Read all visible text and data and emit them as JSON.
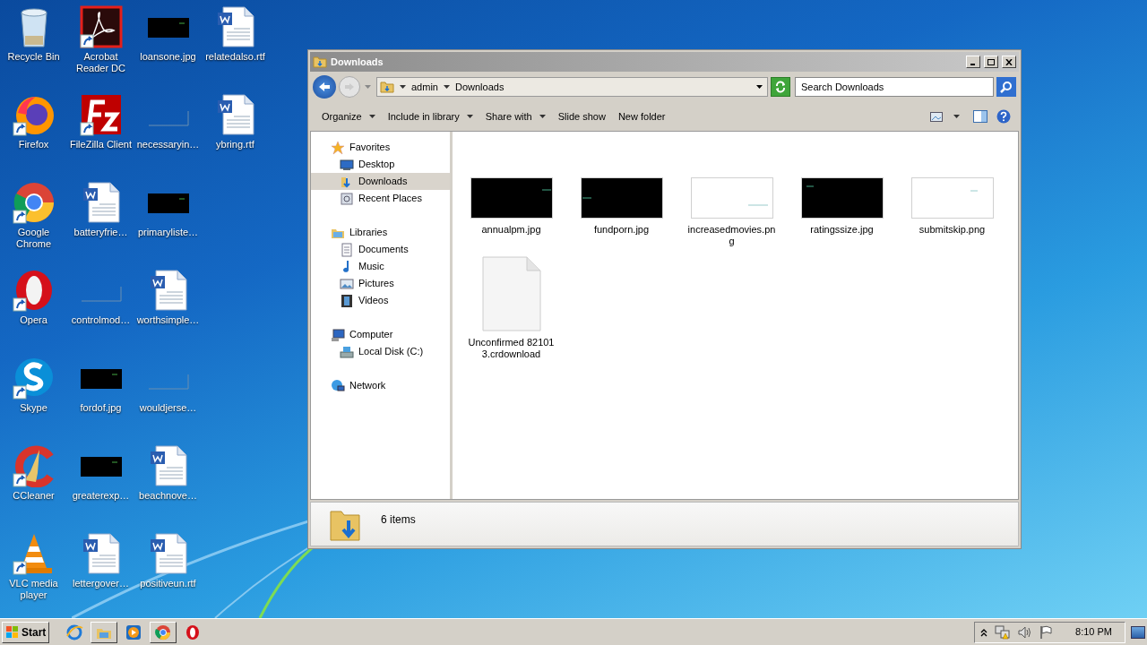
{
  "desktop": {
    "columns": [
      [
        {
          "label": "Recycle Bin",
          "kind": "recycle",
          "shortcut": false
        },
        {
          "label": "Firefox",
          "kind": "firefox",
          "shortcut": true
        },
        {
          "label": "Google Chrome",
          "kind": "chrome",
          "shortcut": true
        },
        {
          "label": "Opera",
          "kind": "opera",
          "shortcut": true
        },
        {
          "label": "Skype",
          "kind": "skype",
          "shortcut": true
        },
        {
          "label": "CCleaner",
          "kind": "ccleaner",
          "shortcut": true
        },
        {
          "label": "VLC media player",
          "kind": "vlc",
          "shortcut": true
        }
      ],
      [
        {
          "label": "Acrobat Reader DC",
          "kind": "acrobat",
          "shortcut": true
        },
        {
          "label": "FileZilla Client",
          "kind": "filezilla",
          "shortcut": true
        },
        {
          "label": "batteryfrie…",
          "kind": "word",
          "shortcut": false
        },
        {
          "label": "controlmod…",
          "kind": "blank",
          "shortcut": false
        },
        {
          "label": "fordof.jpg",
          "kind": "dark",
          "shortcut": false
        },
        {
          "label": "greaterexp…",
          "kind": "dark",
          "shortcut": false
        },
        {
          "label": "lettergover…",
          "kind": "word",
          "shortcut": false
        }
      ],
      [
        {
          "label": "loansone.jpg",
          "kind": "dark",
          "shortcut": false
        },
        {
          "label": "necessaryin…",
          "kind": "blank",
          "shortcut": false
        },
        {
          "label": "primaryliste…",
          "kind": "dark",
          "shortcut": false
        },
        {
          "label": "worthsimple…",
          "kind": "word",
          "shortcut": false
        },
        {
          "label": "wouldjerse…",
          "kind": "blank",
          "shortcut": false
        },
        {
          "label": "beachnove…",
          "kind": "word",
          "shortcut": false
        },
        {
          "label": "positiveun.rtf",
          "kind": "word",
          "shortcut": false
        }
      ],
      [
        {
          "label": "relatedalso.rtf",
          "kind": "word",
          "shortcut": false
        },
        {
          "label": "ybring.rtf",
          "kind": "word",
          "shortcut": false
        }
      ]
    ]
  },
  "window": {
    "title": "Downloads",
    "breadcrumb": [
      "admin",
      "Downloads"
    ],
    "search": {
      "placeholder": "Search Downloads"
    },
    "toolbar": [
      {
        "label": "Organize",
        "menu": true
      },
      {
        "label": "Include in library",
        "menu": true
      },
      {
        "label": "Share with",
        "menu": true
      },
      {
        "label": "Slide show",
        "menu": false
      },
      {
        "label": "New folder",
        "menu": false
      }
    ],
    "nav": [
      {
        "label": "Favorites",
        "kind": "star",
        "selected": false,
        "children": [
          {
            "label": "Desktop",
            "kind": "desktop",
            "selected": false
          },
          {
            "label": "Downloads",
            "kind": "downloads",
            "selected": true
          },
          {
            "label": "Recent Places",
            "kind": "recent",
            "selected": false
          }
        ]
      },
      {
        "label": "Libraries",
        "kind": "library",
        "selected": false,
        "children": [
          {
            "label": "Documents",
            "kind": "documents",
            "selected": false
          },
          {
            "label": "Music",
            "kind": "music",
            "selected": false
          },
          {
            "label": "Pictures",
            "kind": "pictures",
            "selected": false
          },
          {
            "label": "Videos",
            "kind": "videos",
            "selected": false
          }
        ]
      },
      {
        "label": "Computer",
        "kind": "computer",
        "selected": false,
        "children": [
          {
            "label": "Local Disk (C:)",
            "kind": "disk",
            "selected": false
          }
        ]
      },
      {
        "label": "Network",
        "kind": "network",
        "selected": false
      }
    ],
    "files": [
      {
        "name": "annualpm.jpg",
        "kind": "dark"
      },
      {
        "name": "fundporn.jpg",
        "kind": "dark"
      },
      {
        "name": "increasedmovies.png",
        "kind": "light"
      },
      {
        "name": "ratingssize.jpg",
        "kind": "dark"
      },
      {
        "name": "submitskip.png",
        "kind": "light"
      },
      {
        "name": "Unconfirmed 821013.crdownload",
        "kind": "document"
      }
    ],
    "status": "6 items"
  },
  "taskbar": {
    "start": "Start",
    "pinned": [
      {
        "kind": "ie",
        "running": false
      },
      {
        "kind": "explorer",
        "running": true
      },
      {
        "kind": "media",
        "running": false
      },
      {
        "kind": "chrome",
        "running": true
      },
      {
        "kind": "opera",
        "running": false
      }
    ],
    "clock": "8:10 PM"
  }
}
